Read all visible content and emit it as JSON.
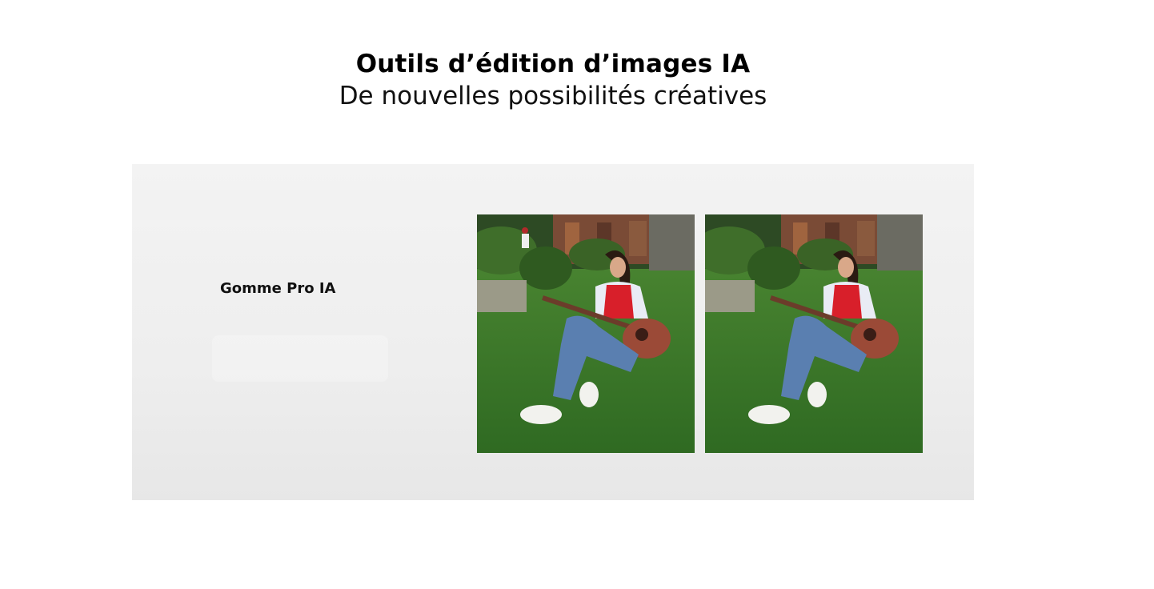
{
  "header": {
    "title": "Outils d’édition d’images IA",
    "subtitle": "De nouvelles possibilités créatives"
  },
  "feature": {
    "label": "Gomme Pro IA"
  },
  "photos": [
    {
      "name": "before",
      "has_background_person": true
    },
    {
      "name": "after",
      "has_background_person": false
    }
  ],
  "colors": {
    "card_background": "#eeeeee",
    "grass": "#3f7a2c",
    "vest": "#d81f2a",
    "jeans": "#5a7fb0",
    "guitar": "#9b4a37"
  }
}
